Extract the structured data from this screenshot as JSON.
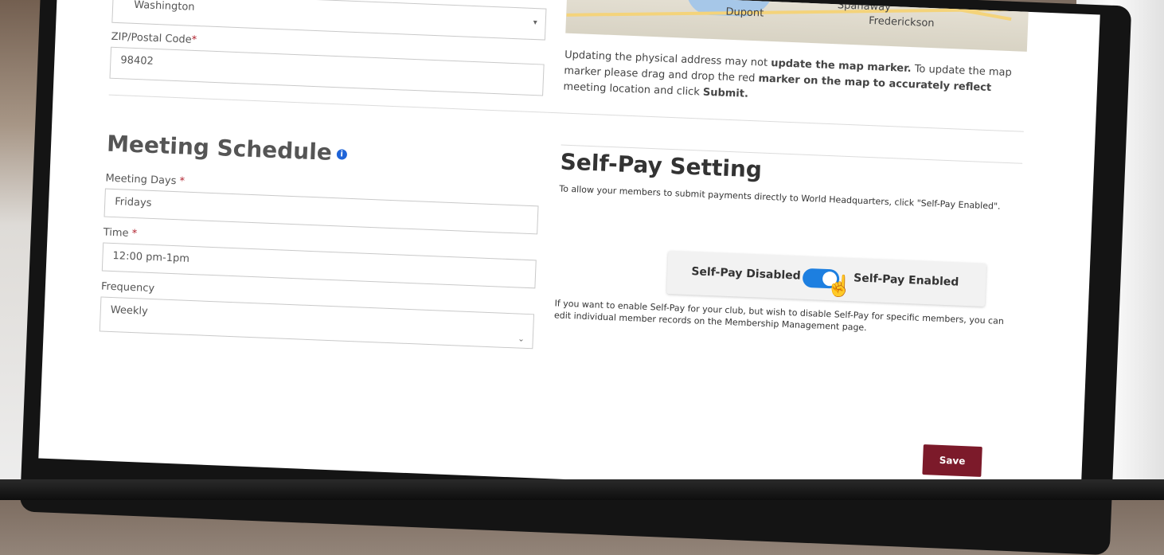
{
  "address": {
    "state_value": "Washington",
    "zip_label": "ZIP/Postal Code",
    "zip_required": "*",
    "zip_value": "98402"
  },
  "map": {
    "labels": [
      "Dupont",
      "Spanaway",
      "Frederickson"
    ],
    "note_part1": "Updating the physical address may not ",
    "note_bold1": "update the map marker.",
    "note_part2": " To update the map marker please drag and drop the red ",
    "note_bold2": "marker on the map to accurately reflect",
    "note_part3": " meeting location and click ",
    "note_bold3": "Submit."
  },
  "meeting_schedule": {
    "title": "Meeting Schedule",
    "info_icon": "i",
    "days_label": "Meeting Days",
    "days_value": "Fridays",
    "time_label": "Time",
    "time_value": "12:00 pm-1pm",
    "frequency_label": "Frequency",
    "frequency_value": "Weekly",
    "required_mark": "*"
  },
  "self_pay": {
    "title": "Self-Pay Setting",
    "description": "To allow your members to submit payments directly to World Headquarters, click \"Self-Pay Enabled\".",
    "disabled_label": "Self-Pay Disabled",
    "enabled_label": "Self-Pay Enabled",
    "toggle_on": true,
    "note": "If you want to enable Self-Pay for your club, but wish to disable Self-Pay for specific members, you can edit individual member records on the Membership Management page."
  },
  "actions": {
    "save_label": "Save"
  },
  "colors": {
    "accent": "#7c1a2a",
    "toggle": "#1d7fe0",
    "required": "#b0202d"
  }
}
